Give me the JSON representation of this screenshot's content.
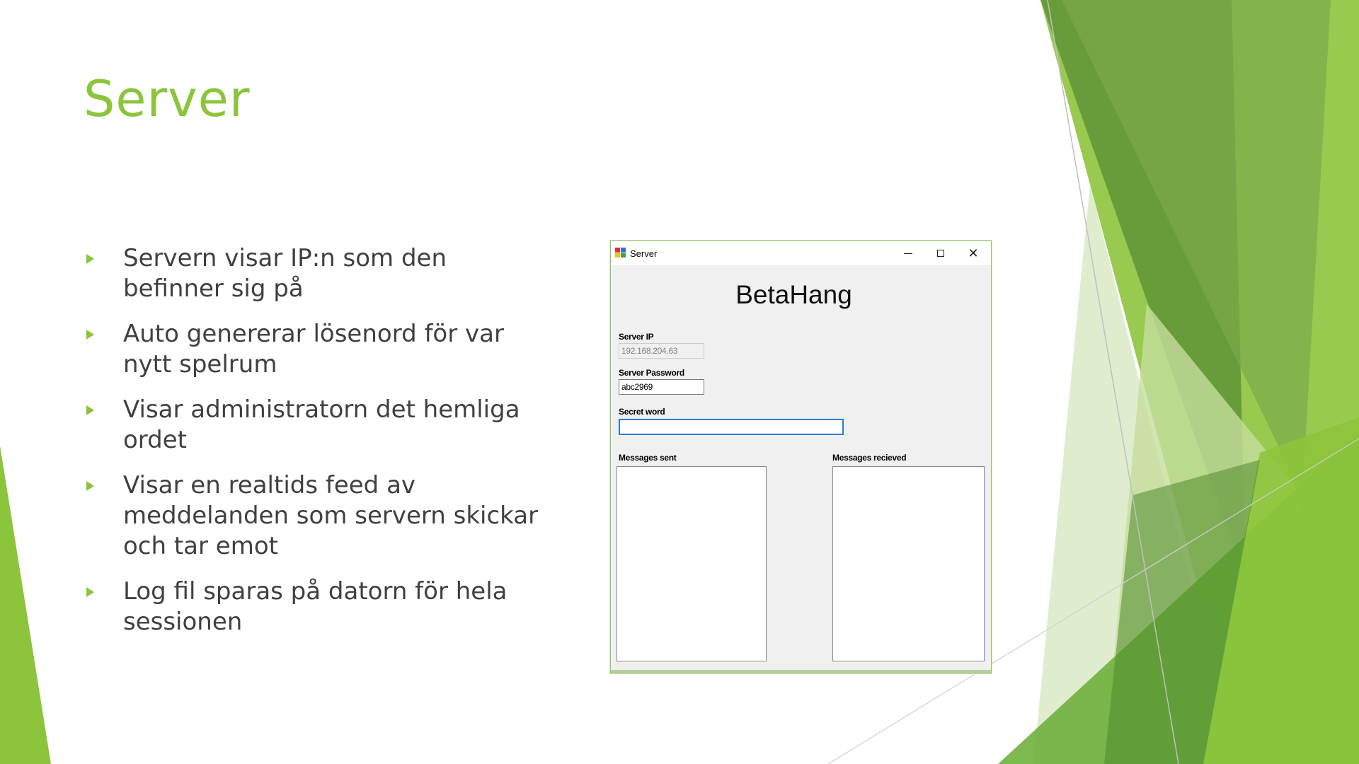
{
  "slide": {
    "title": "Server",
    "bullets": [
      "Servern visar IP:n som den befinner sig på",
      "Auto genererar lösenord för var nytt spelrum",
      "Visar administratorn det hemliga ordet",
      "Visar en realtids feed av meddelanden som servern skickar och tar emot",
      "Log fil sparas på datorn för hela sessionen"
    ]
  },
  "window": {
    "title": "Server",
    "heading": "BetaHang",
    "server_ip_label": "Server IP",
    "server_ip_value": "192.168.204.63",
    "server_password_label": "Server Password",
    "server_password_value": "abc2969",
    "secret_word_label": "Secret word",
    "secret_word_value": "",
    "messages_sent_label": "Messages sent",
    "messages_received_label": "Messages recieved"
  },
  "colors": {
    "accent": "#8cc43b",
    "text": "#404040"
  }
}
